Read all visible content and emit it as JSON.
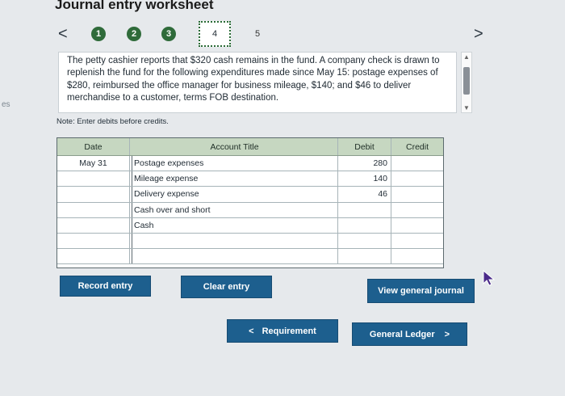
{
  "page": {
    "title": "Journal entry worksheet",
    "side_text": "es"
  },
  "nav": {
    "prev_glyph": "<",
    "next_glyph": ">",
    "steps": [
      "1",
      "2",
      "3",
      "4",
      "5"
    ]
  },
  "problem": {
    "text": "The petty cashier reports that $320 cash remains in the fund. A company check is drawn to replenish the fund for the following expenditures made since May 15: postage expenses of $280, reimbursed the office manager for business mileage, $140; and $46 to deliver merchandise to a customer, terms FOB destination."
  },
  "note": "Note: Enter debits before credits.",
  "journal": {
    "headers": {
      "date": "Date",
      "account": "Account Title",
      "debit": "Debit",
      "credit": "Credit"
    },
    "rows": [
      {
        "date": "May 31",
        "account": "Postage expenses",
        "debit": "280",
        "credit": ""
      },
      {
        "date": "",
        "account": "Mileage expense",
        "debit": "140",
        "credit": ""
      },
      {
        "date": "",
        "account": "Delivery expense",
        "debit": "46",
        "credit": ""
      },
      {
        "date": "",
        "account": "Cash over and short",
        "debit": "",
        "credit": ""
      },
      {
        "date": "",
        "account": "Cash",
        "debit": "",
        "credit": ""
      },
      {
        "date": "",
        "account": "",
        "debit": "",
        "credit": ""
      },
      {
        "date": "",
        "account": "",
        "debit": "",
        "credit": ""
      }
    ]
  },
  "buttons": {
    "record": "Record entry",
    "clear": "Clear entry",
    "view_journal": "View general journal",
    "requirement": "Requirement",
    "requirement_arrow": "<",
    "ledger": "General Ledger",
    "ledger_arrow": ">"
  },
  "colors": {
    "step_fill": "#2f6b3a",
    "header_fill": "#c6d7c1",
    "button_fill": "#1d5f8e"
  }
}
